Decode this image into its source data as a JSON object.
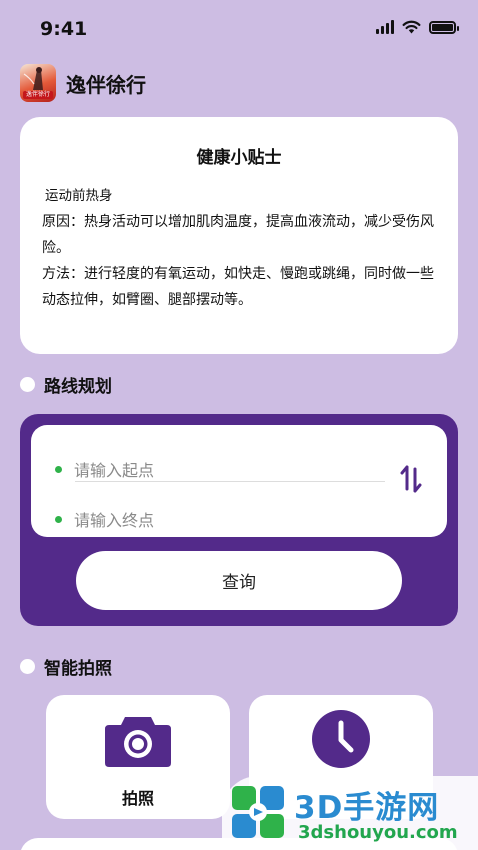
{
  "status_bar": {
    "time": "9:41"
  },
  "app": {
    "title": "逸伴徐行",
    "logo_text": "逸伴徐行"
  },
  "tips": {
    "title": "健康小贴士",
    "subtitle": "运动前热身",
    "reason": "原因：热身活动可以增加肌肉温度，提高血液流动，减少受伤风险。",
    "method": "方法：进行轻度的有氧运动，如快走、慢跑或跳绳，同时做一些动态拉伸，如臂圈、腿部摆动等。"
  },
  "route": {
    "section_title": "路线规划",
    "start_placeholder": "请输入起点",
    "end_placeholder": "请输入终点",
    "query_label": "查询"
  },
  "smart_photo": {
    "section_title": "智能拍照",
    "cards": [
      {
        "label": "拍照",
        "icon": "camera-icon"
      },
      {
        "label": "",
        "icon": "clock-icon"
      }
    ]
  },
  "watermark": {
    "main": "3D手游网",
    "sub": "3dshouyou.com"
  },
  "colors": {
    "background": "#cdbde3",
    "accent": "#532a8a",
    "dot_green": "#2fb24a",
    "card": "#ffffff"
  }
}
